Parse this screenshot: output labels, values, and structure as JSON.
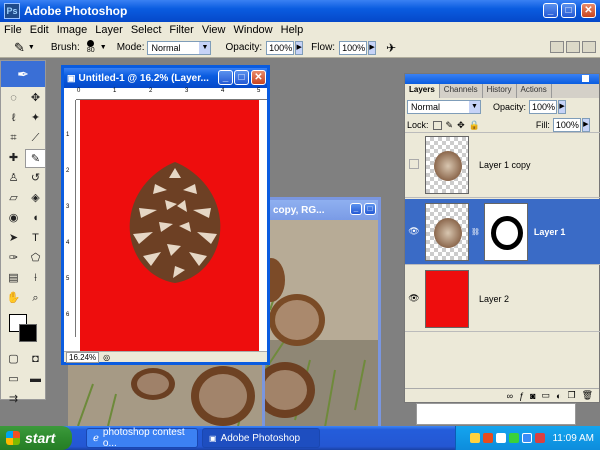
{
  "app": {
    "title": "Adobe Photoshop",
    "logo_text": "Ps"
  },
  "window_buttons": {
    "min": "_",
    "max": "□",
    "close": "✕"
  },
  "menu": [
    "File",
    "Edit",
    "Image",
    "Layer",
    "Select",
    "Filter",
    "View",
    "Window",
    "Help"
  ],
  "options": {
    "brush_label": "Brush:",
    "brush_size": "80",
    "mode_label": "Mode:",
    "mode_value": "Normal",
    "opacity_label": "Opacity:",
    "opacity_value": "100%",
    "flow_label": "Flow:",
    "flow_value": "100%"
  },
  "doc_front": {
    "title": "Untitled-1 @ 16.2% (Layer...",
    "zoom": "16.24%",
    "canvas_color": "#ee0d0d"
  },
  "doc_back": {
    "title": "copy, RG..."
  },
  "ruler_h_ticks": [
    "0",
    "1",
    "2",
    "3",
    "4",
    "5"
  ],
  "ruler_v_ticks": [
    "1",
    "2",
    "3",
    "4",
    "5",
    "6"
  ],
  "layers_panel": {
    "tabs": [
      "Layers",
      "Channels",
      "History",
      "Actions"
    ],
    "blend_mode": "Normal",
    "opacity_label": "Opacity:",
    "opacity_value": "100%",
    "lock_label": "Lock:",
    "fill_label": "Fill:",
    "fill_value": "100%",
    "layers": [
      {
        "name": "Layer 1 copy",
        "visible": false,
        "selected": false
      },
      {
        "name": "Layer 1",
        "visible": true,
        "selected": true
      },
      {
        "name": "Layer 2",
        "visible": true,
        "selected": false
      }
    ]
  },
  "taskbar": {
    "start_label": "start",
    "tasks": [
      "photoshop contest o...",
      "Adobe Photoshop"
    ],
    "clock": "11:09 AM"
  }
}
